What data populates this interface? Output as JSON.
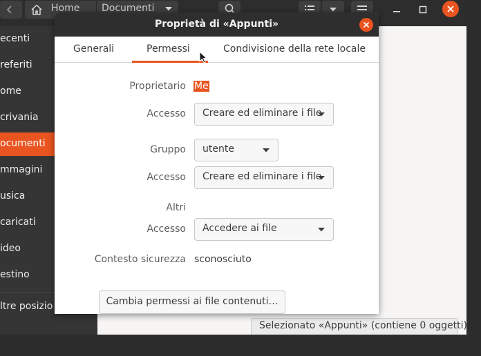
{
  "file_manager": {
    "path": {
      "home_label": "Home",
      "current_label": "Documenti"
    },
    "sidebar": {
      "items": [
        {
          "label": "ecenti",
          "active": false
        },
        {
          "label": "referiti",
          "active": false
        },
        {
          "label": "ome",
          "active": false
        },
        {
          "label": "crivania",
          "active": false
        },
        {
          "label": "ocumenti",
          "active": true
        },
        {
          "label": "mmagini",
          "active": false
        },
        {
          "label": "usica",
          "active": false
        },
        {
          "label": "caricati",
          "active": false
        },
        {
          "label": "ideo",
          "active": false
        },
        {
          "label": "estino",
          "active": false
        }
      ],
      "other_locations_label": "ltre posizio"
    },
    "statusbar": {
      "text": "Selezionato «Appunti»  (contiene 0 oggetti)"
    }
  },
  "dialog": {
    "title": "Proprietà di «Appunti»",
    "tabs": [
      {
        "label": "Generali",
        "active": false
      },
      {
        "label": "Permessi",
        "active": true
      },
      {
        "label": "Condivisione della rete locale",
        "active": false
      }
    ],
    "permissions": {
      "owner_label": "Proprietario",
      "owner_value": "Me",
      "owner_access_label": "Accesso",
      "owner_access_value": "Creare ed eliminare i file",
      "group_label": "Gruppo",
      "group_value": "utente",
      "group_access_label": "Accesso",
      "group_access_value": "Creare ed eliminare i file",
      "others_label": "Altri",
      "others_access_label": "Accesso",
      "others_access_value": "Accedere ai file",
      "security_context_label": "Contesto sicurezza",
      "security_context_value": "sconosciuto",
      "change_permissions_button": "Cambia permessi ai file contenuti…"
    }
  },
  "colors": {
    "accent": "#e95420",
    "title_bar": "#2e2e2e",
    "sidebar_bg": "#353535",
    "dialog_bg": "#ffffff"
  }
}
